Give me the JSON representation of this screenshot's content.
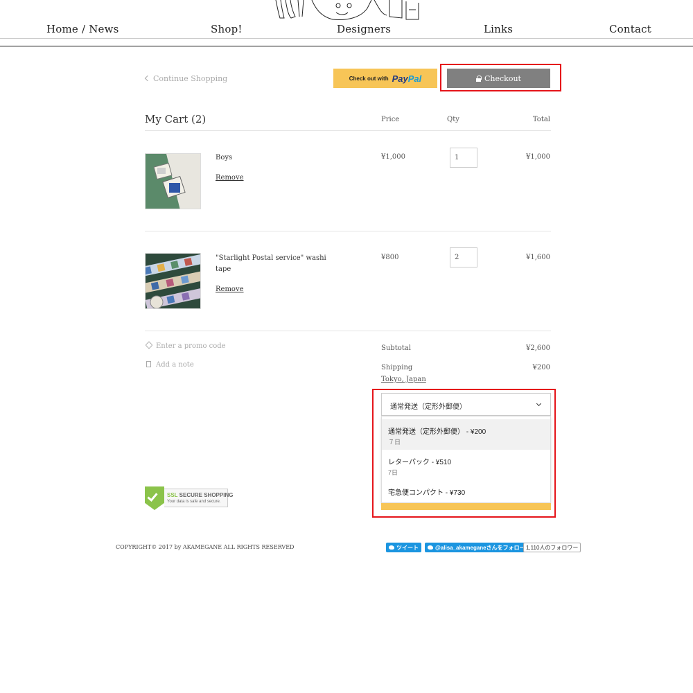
{
  "nav": {
    "home_news": "Home / News",
    "shop": "Shop!",
    "designers": "Designers",
    "links": "Links",
    "contact": "Contact"
  },
  "actions": {
    "continue_shopping": "Continue Shopping",
    "paypal_prefix": "Check out with",
    "paypal_brand_1": "Pay",
    "paypal_brand_2": "Pal",
    "checkout_label": "Checkout"
  },
  "cart": {
    "title": "My Cart (2)",
    "columns": {
      "price": "Price",
      "qty": "Qty",
      "total": "Total"
    },
    "items": [
      {
        "name": "Boys",
        "price": "¥1,000",
        "qty": "1",
        "total": "¥1,000",
        "remove": "Remove"
      },
      {
        "name": "\"Starlight Postal service\" washi tape",
        "price": "¥800",
        "qty": "2",
        "total": "¥1,600",
        "remove": "Remove"
      }
    ]
  },
  "aside": {
    "promo": "Enter a promo code",
    "note": "Add a note"
  },
  "summary": {
    "subtotal_label": "Subtotal",
    "subtotal_value": "¥2,600",
    "shipping_label": "Shipping",
    "shipping_value": "¥200",
    "shipping_location": "Tokyo, Japan",
    "selected_method": "通常発送（定形外郵便）",
    "options": [
      {
        "name": "通常発送（定形外郵便）",
        "price": "- ¥200",
        "days": "７日"
      },
      {
        "name": "レターパック",
        "price": "- ¥510",
        "days": "7日"
      },
      {
        "name": "宅急便コンパクト",
        "price": "- ¥730",
        "days": ""
      }
    ]
  },
  "ssl": {
    "title_a": "SSL",
    "title_b": "SECURE SHOPPING",
    "subtitle": "Your data is safe and secure."
  },
  "footer": {
    "copyright": "COPYRIGHT© 2017 by AKAMEGANE ALL RIGHTS RESERVED",
    "tweet": "ツイート",
    "follow": "@alisa_akameganeさんをフォロー",
    "follower_count": "1,110人のフォロワー"
  },
  "colors": {
    "paypal_yellow": "#f7c557",
    "checkout_gray": "#808080",
    "highlight_red": "#e5141a",
    "twitter_blue": "#1b95e0"
  }
}
